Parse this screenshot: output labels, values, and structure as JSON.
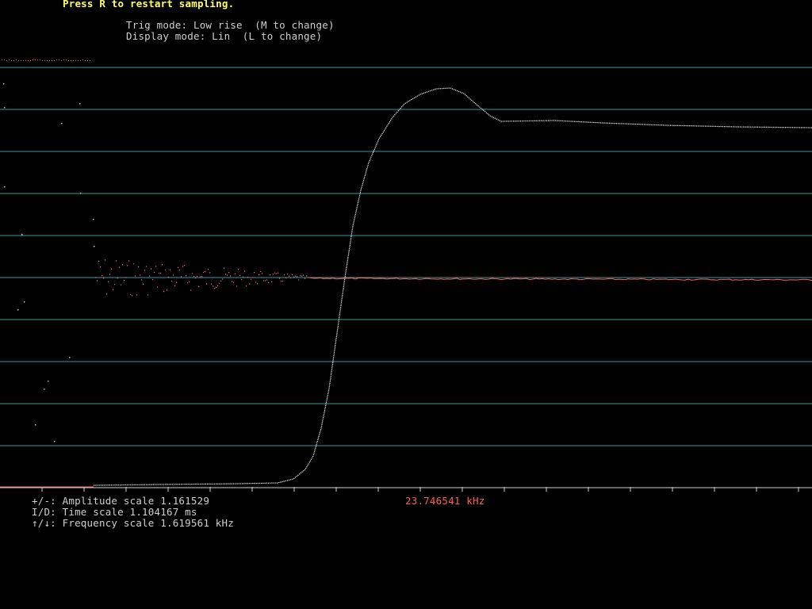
{
  "header": {
    "restart_hint": "Press R to restart sampling.",
    "trig_mode": "Trig mode: Low rise  (M to change)",
    "display_mode": "Display mode: Lin  (L to change)"
  },
  "footer": {
    "amplitude": "+/-: Amplitude scale 1.161529",
    "time": "I/D: Time scale 1.104167 ms",
    "frequency": "↑/↓: Frequency scale 1.619561 kHz",
    "frequency_readout": "23.746541 kHz"
  },
  "colors": {
    "background": "#000000",
    "grid": "#3a9aa0",
    "trace": "#ffffff",
    "spectrum": "#ff6a6a",
    "hint": "#ffff66",
    "label": "#cfcfcf",
    "readout": "#ff5a5a"
  }
}
